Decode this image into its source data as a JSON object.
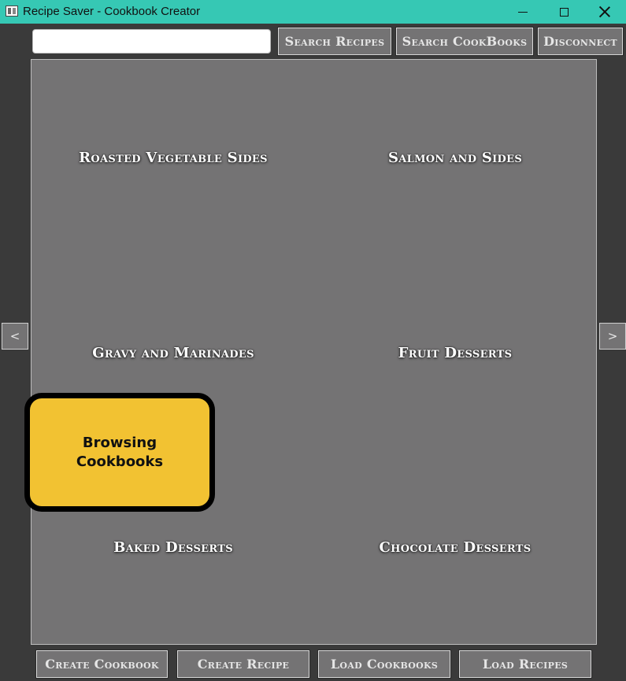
{
  "window": {
    "title": "Recipe Saver - Cookbook Creator",
    "controls": [
      "minimize-icon",
      "maximize-icon",
      "close-icon"
    ],
    "titlebar_color": "#36c8b4"
  },
  "toolbar": {
    "search": {
      "value": "",
      "placeholder": ""
    },
    "search_recipes_label": "Search Recipes",
    "search_cookbooks_label": "Search CookBooks",
    "disconnect_label": "Disconnect"
  },
  "cookbooks": [
    "Roasted Vegetable Sides",
    "Salmon and Sides",
    "Gravy and Marinades",
    "Fruit Desserts",
    "Baked Desserts",
    "Chocolate Desserts"
  ],
  "nav": {
    "prev_label": "<",
    "next_label": ">"
  },
  "status": {
    "text": "Browsing Cookbooks",
    "color": "#f2c232"
  },
  "bottom": {
    "create_cookbook_label": "Create Cookbook",
    "create_recipe_label": "Create Recipe",
    "load_cookbooks_label": "Load Cookbooks",
    "load_recipes_label": "Load Recipes"
  }
}
